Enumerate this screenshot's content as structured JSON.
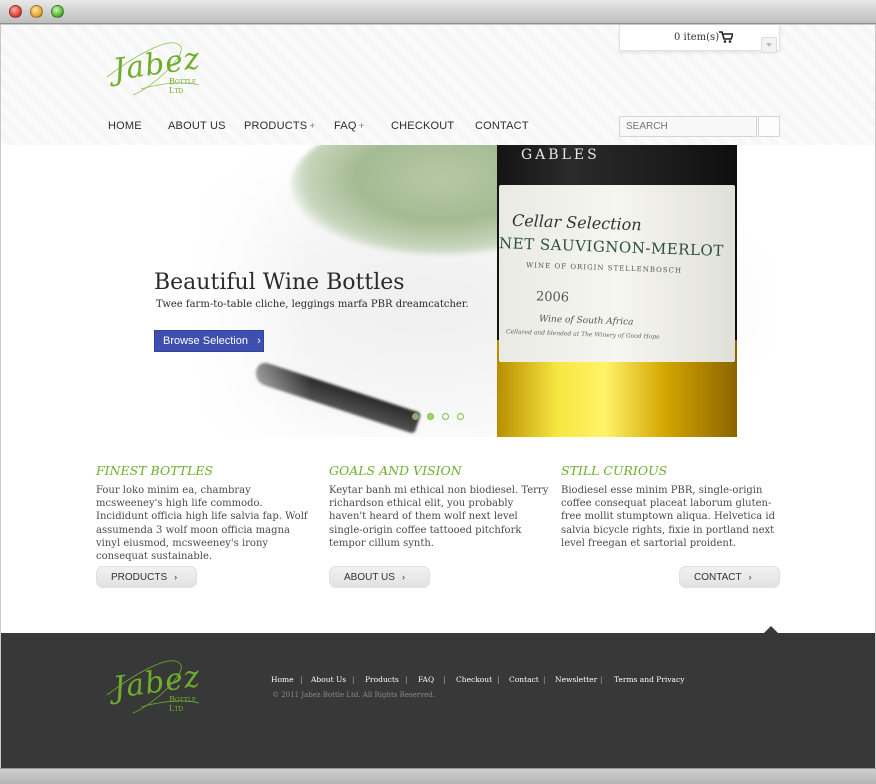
{
  "cart": {
    "text": "0 item(s)"
  },
  "logo": {
    "script": "Jabez",
    "sub": "Bottle Ltd"
  },
  "nav": {
    "items": [
      {
        "label": "HOME"
      },
      {
        "label": "ABOUT US"
      },
      {
        "label": "PRODUCTS"
      },
      {
        "label": "FAQ"
      },
      {
        "label": "CHECKOUT"
      },
      {
        "label": "CONTACT"
      }
    ],
    "plus": "+"
  },
  "search": {
    "placeholder": "SEARCH"
  },
  "hero": {
    "title": "Beautiful Wine Bottles",
    "subtitle": "Twee farm-to-table cliche, leggings marfa PBR dreamcatcher.",
    "button": "Browse Selection",
    "button_chevron": "›",
    "bottle_label": {
      "top": "GABLES",
      "line1": "Cellar Selection",
      "line2": "NET SAUVIGNON-MERLOT",
      "line3": "WINE OF ORIGIN STELLENBOSCH",
      "year": "2006",
      "origin": "Wine of South Africa",
      "small": "Cellared and blended at The Winery of Good Hope"
    },
    "slides": 4,
    "active_slide": 1
  },
  "columns": [
    {
      "title": "FINEST BOTTLES",
      "text": "Four loko minim ea, chambray mcsweeney's high life commodo. Incididunt officia high life salvia fap. Wolf assumenda 3 wolf moon officia magna vinyl eiusmod, mcsweeney's irony consequat sustainable.",
      "button": "PRODUCTS"
    },
    {
      "title": "GOALS AND VISION",
      "text": "Keytar banh mi ethical non biodiesel. Terry richardson ethical elit, you probably haven't heard of them wolf next level single-origin coffee tattooed pitchfork tempor cillum synth.",
      "button": "ABOUT US"
    },
    {
      "title": "STILL CURIOUS",
      "text": "Biodiesel esse minim PBR, single-origin coffee consequat placeat laborum gluten-free mollit stumptown aliqua. Helvetica id salvia bicycle rights, fixie in portland next level freegan et sartorial proident.",
      "button": "CONTACT"
    }
  ],
  "chevron": "›",
  "footer": {
    "links": [
      "Home",
      "About Us",
      "Products",
      "FAQ",
      "Checkout",
      "Contact",
      "Newsletter",
      "Terms and Privacy"
    ],
    "separator": "|",
    "copyright": "© 2011 Jabez Bottle Ltd. All Rights Reserved."
  },
  "colors": {
    "accent_green": "#6fae2c",
    "button_blue": "#3e4fb0",
    "footer_bg": "#383838"
  }
}
